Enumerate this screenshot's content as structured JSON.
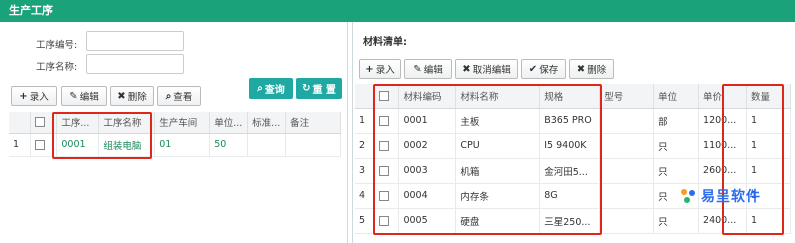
{
  "app": {
    "title": "生产工序"
  },
  "left": {
    "form": {
      "code_label": "工序编号:",
      "code_value": "",
      "name_label": "工序名称:",
      "name_value": ""
    },
    "toolbar": {
      "add_label": "录入",
      "edit_label": "编辑",
      "delete_label": "删除",
      "view_label": "查看",
      "query_label": "查询",
      "reset_label": "重 置"
    },
    "table": {
      "headers": [
        "工序...",
        "工序名称",
        "生产车间",
        "单位...",
        "标准...",
        "备注"
      ],
      "rows": [
        {
          "num": "1",
          "code": "0001",
          "name": "组装电脑",
          "workshop": "01",
          "unit": "50",
          "standard": "",
          "remark": ""
        }
      ]
    }
  },
  "right": {
    "section_title": "材料清单:",
    "toolbar": {
      "add_label": "录入",
      "edit_label": "编辑",
      "cancel_label": "取消编辑",
      "save_label": "保存",
      "delete_label": "删除"
    },
    "table": {
      "headers": [
        "材料编码",
        "材料名称",
        "规格",
        "型号",
        "单位",
        "单价",
        "数量"
      ],
      "rows": [
        {
          "num": "1",
          "code": "0001",
          "name": "主板",
          "spec": "B365 PRO",
          "model": "",
          "unit": "部",
          "price": "1200...",
          "qty": "1"
        },
        {
          "num": "2",
          "code": "0002",
          "name": "CPU",
          "spec": "I5 9400K",
          "model": "",
          "unit": "只",
          "price": "1100...",
          "qty": "1"
        },
        {
          "num": "3",
          "code": "0003",
          "name": "机箱",
          "spec": "金河田5...",
          "model": "",
          "unit": "只",
          "price": "2600...",
          "qty": "1"
        },
        {
          "num": "4",
          "code": "0004",
          "name": "内存条",
          "spec": "8G",
          "model": "",
          "unit": "只",
          "price": "",
          "qty": "1"
        },
        {
          "num": "5",
          "code": "0005",
          "name": "硬盘",
          "spec": "三星250...",
          "model": "",
          "unit": "只",
          "price": "2400...",
          "qty": "1"
        }
      ]
    }
  },
  "watermark": {
    "text": "易呈软件"
  },
  "colors": {
    "header_bg": "#1aa37a",
    "query_bg": "#1fa9a2",
    "highlight": "#e0251b",
    "watermark": "#2b6cf0"
  }
}
